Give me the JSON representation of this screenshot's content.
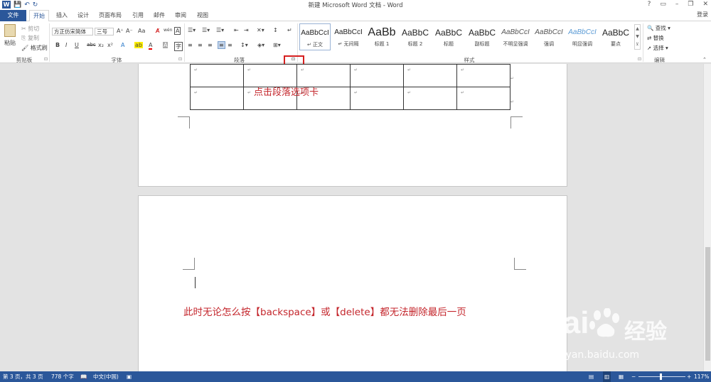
{
  "window": {
    "title": "新建 Microsoft Word 文档 - Word",
    "controls": [
      "?",
      "▭",
      "–",
      "❐",
      "✕"
    ],
    "login": "登录"
  },
  "qat": {
    "logo": "W",
    "save": "💾",
    "undo": "↶",
    "redo": "↻"
  },
  "tabs": [
    {
      "label": "文件"
    },
    {
      "label": "开始"
    },
    {
      "label": "插入"
    },
    {
      "label": "设计"
    },
    {
      "label": "页面布局"
    },
    {
      "label": "引用"
    },
    {
      "label": "邮件"
    },
    {
      "label": "审阅"
    },
    {
      "label": "视图"
    }
  ],
  "clipboard": {
    "paste": "粘贴",
    "cut": "剪切",
    "copy": "复制",
    "format_painter": "格式刷",
    "group": "剪贴板"
  },
  "font": {
    "family": "方正仿宋简体",
    "size": "三号",
    "grow": "A⁺",
    "shrink": "A⁻",
    "case": "Aa",
    "clear": "A̸",
    "phonetic": "wén",
    "border": "A",
    "bold": "B",
    "italic": "I",
    "underline": "U",
    "strike": "abc",
    "sub": "x₂",
    "sup": "x²",
    "effects": "A",
    "highlight": "ab",
    "color": "A",
    "shading": "A",
    "group": "字体"
  },
  "paragraph": {
    "group": "段落",
    "launcher": "⊡"
  },
  "styles": {
    "group": "样式",
    "items": [
      {
        "sample": "AaBbCcI",
        "name": "↵ 正文"
      },
      {
        "sample": "AaBbCcI",
        "name": "↵ 无间隔"
      },
      {
        "sample": "AaBb",
        "name": "标题 1"
      },
      {
        "sample": "AaBbC",
        "name": "标题 2"
      },
      {
        "sample": "AaBbC",
        "name": "标题"
      },
      {
        "sample": "AaBbC",
        "name": "副标题"
      },
      {
        "sample": "AaBbCcI",
        "name": "不明显强调"
      },
      {
        "sample": "AaBbCcI",
        "name": "强调"
      },
      {
        "sample": "AaBbCcI",
        "name": "明显强调"
      },
      {
        "sample": "AaBbC",
        "name": "要点"
      }
    ]
  },
  "editing": {
    "find": "查找",
    "replace": "替换",
    "select": "选择",
    "group": "编辑"
  },
  "document": {
    "para_mark": "↵",
    "annotation_1": "点击段落选项卡",
    "annotation_2": "此时无论怎么按【backspace】或【delete】都无法删除最后一页"
  },
  "status": {
    "page": "第 3 页，共 3 页",
    "words": "778 个字",
    "lang": "中文(中国)",
    "zoom": "117%"
  },
  "watermark": {
    "brand": "Bai",
    "brand2": "经验",
    "url": "jingyan.baidu.com"
  }
}
